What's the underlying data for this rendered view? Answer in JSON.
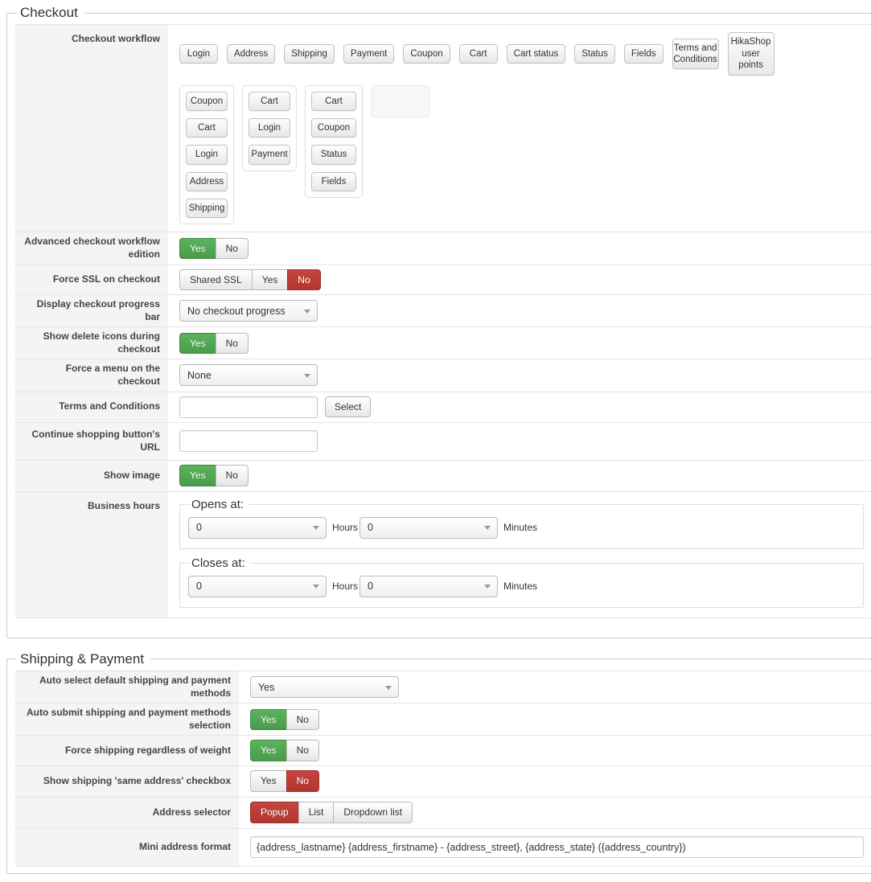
{
  "colors": {
    "active_yes_green": "#4a9c4a",
    "active_no_red": "#b23530"
  },
  "checkout": {
    "legend": "Checkout",
    "workflow": {
      "label": "Checkout workflow",
      "top_buttons": [
        "Login",
        "Address",
        "Shipping",
        "Payment",
        "Coupon",
        "Cart",
        "Cart status",
        "Status",
        "Fields",
        "Terms and Conditions",
        "HikaShop user points"
      ],
      "columns": [
        [
          "Coupon",
          "Cart",
          "Login",
          "Address",
          "Shipping"
        ],
        [
          "Cart",
          "Login",
          "Payment"
        ],
        [
          "Cart",
          "Coupon",
          "Status",
          "Fields"
        ]
      ]
    },
    "advanced_edition": {
      "label": "Advanced checkout workflow edition",
      "options": [
        "Yes",
        "No"
      ],
      "active": "Yes"
    },
    "force_ssl": {
      "label": "Force SSL on checkout",
      "options": [
        "Shared SSL",
        "Yes",
        "No"
      ],
      "active": "No"
    },
    "progress_bar": {
      "label": "Display checkout progress bar",
      "value": "No checkout progress"
    },
    "delete_icons": {
      "label": "Show delete icons during checkout",
      "options": [
        "Yes",
        "No"
      ],
      "active": "Yes"
    },
    "force_menu": {
      "label": "Force a menu on the checkout",
      "value": "None"
    },
    "terms": {
      "label": "Terms and Conditions",
      "input_value": "",
      "button": "Select"
    },
    "continue_url": {
      "label": "Continue shopping button's URL",
      "input_value": ""
    },
    "show_image": {
      "label": "Show image",
      "options": [
        "Yes",
        "No"
      ],
      "active": "Yes"
    },
    "business_hours": {
      "label": "Business hours",
      "opens": {
        "legend": "Opens at:",
        "hour_value": "0",
        "hour_label": "Hours",
        "minute_value": "0",
        "minute_label": "Minutes"
      },
      "closes": {
        "legend": "Closes at:",
        "hour_value": "0",
        "hour_label": "Hours",
        "minute_value": "0",
        "minute_label": "Minutes"
      }
    }
  },
  "shipping_payment": {
    "legend": "Shipping & Payment",
    "auto_select": {
      "label": "Auto select default shipping and payment methods",
      "value": "Yes"
    },
    "auto_submit": {
      "label": "Auto submit shipping and payment methods selection",
      "options": [
        "Yes",
        "No"
      ],
      "active": "Yes"
    },
    "force_shipping": {
      "label": "Force shipping regardless of weight",
      "options": [
        "Yes",
        "No"
      ],
      "active": "Yes"
    },
    "same_address": {
      "label": "Show shipping 'same address' checkbox",
      "options": [
        "Yes",
        "No"
      ],
      "active": "No"
    },
    "address_selector": {
      "label": "Address selector",
      "options": [
        "Popup",
        "List",
        "Dropdown list"
      ],
      "active": "Popup"
    },
    "mini_address": {
      "label": "Mini address format",
      "input_value": "{address_lastname} {address_firstname} - {address_street}, {address_state} ({address_country})"
    }
  }
}
